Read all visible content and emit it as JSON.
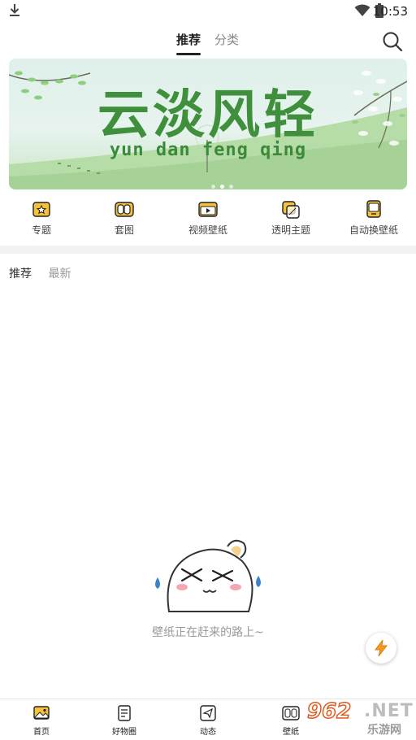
{
  "status_bar": {
    "time": "10:53"
  },
  "top_tabs": [
    {
      "label": "推荐"
    },
    {
      "label": "分类"
    }
  ],
  "banner": {
    "title": "云淡风轻",
    "subtitle": "yun dan feng qing"
  },
  "quick_items": [
    {
      "label": "专题",
      "icon": "star-frame-icon"
    },
    {
      "label": "套图",
      "icon": "image-set-icon"
    },
    {
      "label": "视频壁纸",
      "icon": "video-wallpaper-icon"
    },
    {
      "label": "透明主题",
      "icon": "transparent-theme-icon"
    },
    {
      "label": "自动换壁纸",
      "icon": "auto-wallpaper-icon"
    }
  ],
  "sub_tabs": [
    {
      "label": "推荐"
    },
    {
      "label": "最新"
    }
  ],
  "empty_state": {
    "text": "壁纸正在赶来的路上~"
  },
  "bottom_nav": [
    {
      "label": "首页",
      "icon": "home-image-icon"
    },
    {
      "label": "好物圈",
      "icon": "notebook-icon"
    },
    {
      "label": "动态",
      "icon": "paper-plane-icon"
    },
    {
      "label": "壁纸",
      "icon": "wallpaper-icon"
    }
  ],
  "watermark": {
    "number": "962",
    "net": ".NET",
    "cn": "乐游网"
  },
  "colors": {
    "accent_yellow": "#f5c23c",
    "banner_green": "#3f8f3d",
    "fab_orange": "#f29a1f"
  }
}
